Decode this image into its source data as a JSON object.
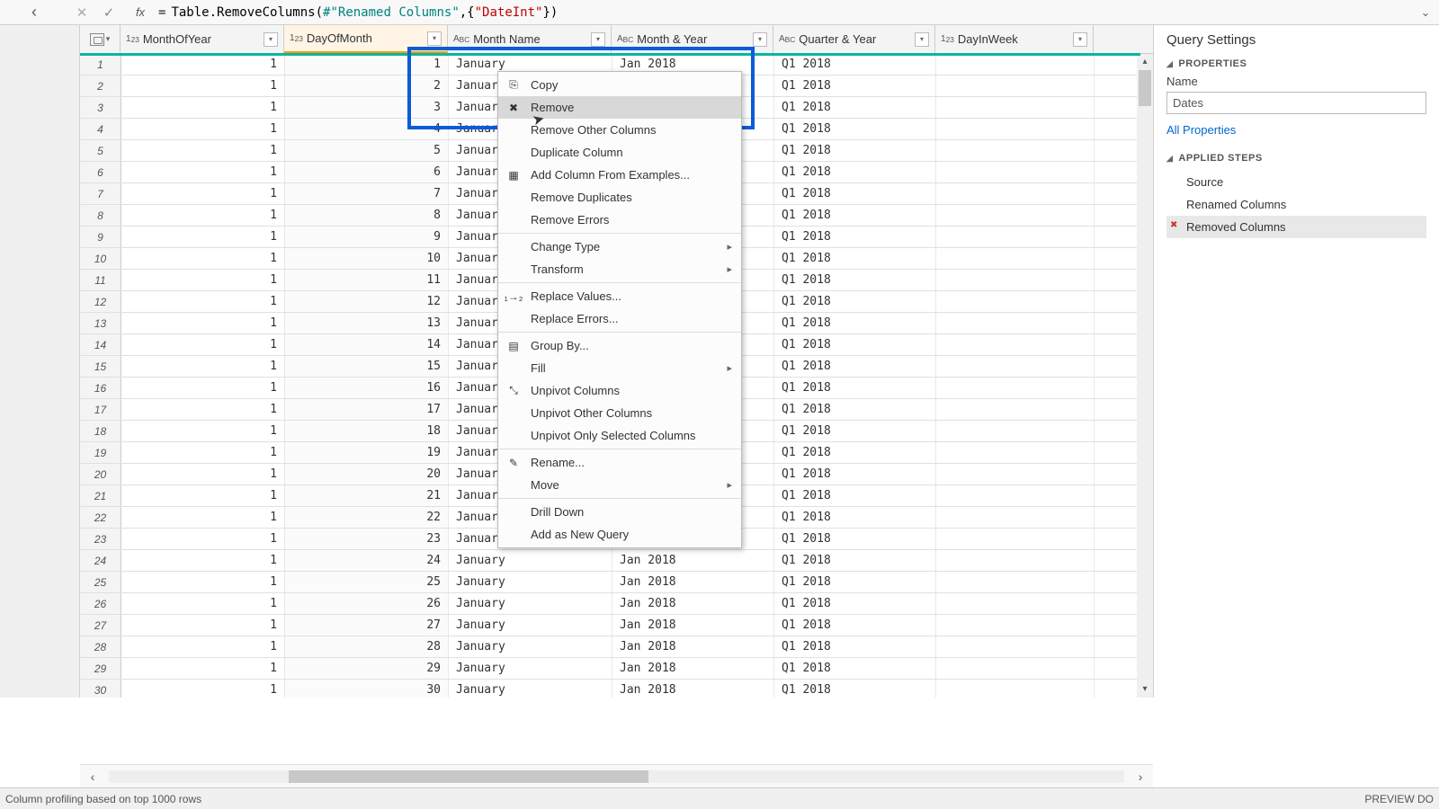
{
  "formula": {
    "prefix": "= ",
    "func": "Table.RemoveColumns",
    "arg1": "#\"Renamed Columns\"",
    "arg2": "\"DateInt\"",
    "raw": "= Table.RemoveColumns(#\"Renamed Columns\",{\"DateInt\"})"
  },
  "columns": [
    {
      "name": "MonthOfYear",
      "type": "123"
    },
    {
      "name": "DayOfMonth",
      "type": "123",
      "selected": true
    },
    {
      "name": "Month Name",
      "type": "ABC"
    },
    {
      "name": "Month & Year",
      "type": "ABC"
    },
    {
      "name": "Quarter & Year",
      "type": "ABC"
    },
    {
      "name": "DayInWeek",
      "type": "123"
    }
  ],
  "row_count": 30,
  "cell_values": {
    "month_of_year": 1,
    "day_of_month_start": 1,
    "month_name": "January",
    "month_year": "Jan 2018",
    "quarter_year": "Q1 2018"
  },
  "context_menu": [
    {
      "label": "Copy",
      "icon": "copy"
    },
    {
      "label": "Remove",
      "icon": "remove",
      "highlight": true
    },
    {
      "label": "Remove Other Columns"
    },
    {
      "label": "Duplicate Column"
    },
    {
      "label": "Add Column From Examples...",
      "icon": "col"
    },
    {
      "label": "Remove Duplicates"
    },
    {
      "label": "Remove Errors"
    },
    {
      "sep": true
    },
    {
      "label": "Change Type",
      "sub": true
    },
    {
      "label": "Transform",
      "sub": true
    },
    {
      "sep": true
    },
    {
      "label": "Replace Values...",
      "icon": "repl"
    },
    {
      "label": "Replace Errors..."
    },
    {
      "sep": true
    },
    {
      "label": "Group By...",
      "icon": "group"
    },
    {
      "label": "Fill",
      "sub": true
    },
    {
      "label": "Unpivot Columns",
      "icon": "unpiv"
    },
    {
      "label": "Unpivot Other Columns"
    },
    {
      "label": "Unpivot Only Selected Columns"
    },
    {
      "sep": true
    },
    {
      "label": "Rename...",
      "icon": "rename"
    },
    {
      "label": "Move",
      "sub": true
    },
    {
      "sep": true
    },
    {
      "label": "Drill Down"
    },
    {
      "label": "Add as New Query"
    }
  ],
  "query_settings": {
    "title": "Query Settings",
    "properties_label": "PROPERTIES",
    "name_label": "Name",
    "name_value": "Dates",
    "all_props": "All Properties",
    "applied_label": "APPLIED STEPS",
    "steps": [
      {
        "label": "Source"
      },
      {
        "label": "Renamed Columns"
      },
      {
        "label": "Removed Columns",
        "active": true
      }
    ]
  },
  "status": {
    "left": "Column profiling based on top 1000 rows",
    "right": "PREVIEW DO"
  }
}
